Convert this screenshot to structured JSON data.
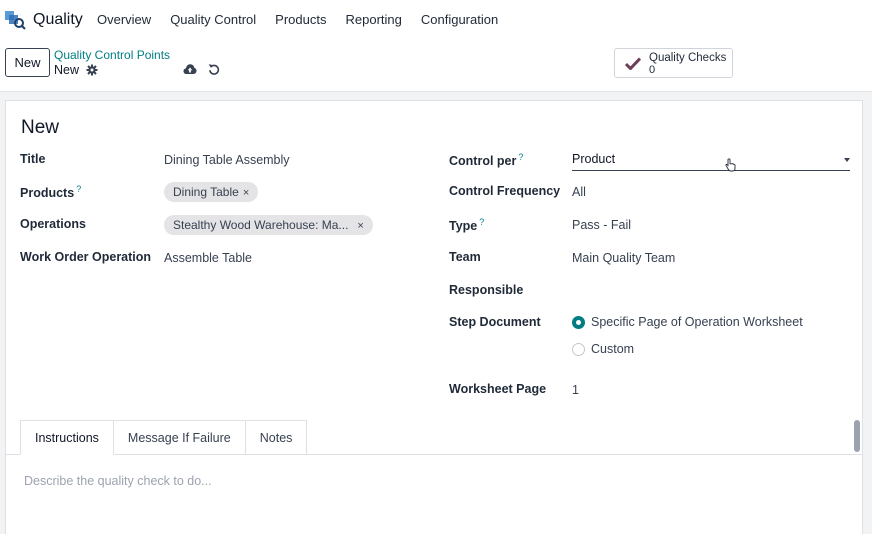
{
  "navbar": {
    "app_name": "Quality",
    "menu": [
      "Overview",
      "Quality Control",
      "Products",
      "Reporting",
      "Configuration"
    ]
  },
  "control_panel": {
    "new_label": "New",
    "breadcrumb_parent": "Quality Control Points",
    "breadcrumb_current": "New",
    "smart_button": {
      "label": "Quality Checks",
      "value": "0"
    }
  },
  "form": {
    "record_title": "New",
    "left": {
      "title_label": "Title",
      "title_value": "Dining Table Assembly",
      "products_label": "Products",
      "products_tags": [
        "Dining Table"
      ],
      "operations_label": "Operations",
      "operations_tags": [
        "Stealthy Wood Warehouse: Ma..."
      ],
      "work_order_label": "Work Order Operation",
      "work_order_value": "Assemble Table"
    },
    "right": {
      "control_per_label": "Control per",
      "control_per_value": "Product",
      "frequency_label": "Control Frequency",
      "frequency_value": "All",
      "type_label": "Type",
      "type_value": "Pass - Fail",
      "team_label": "Team",
      "team_value": "Main Quality Team",
      "responsible_label": "Responsible",
      "responsible_value": "",
      "step_document_label": "Step Document",
      "step_options": [
        "Specific Page of Operation Worksheet",
        "Custom"
      ],
      "step_selected": "Specific Page of Operation Worksheet",
      "worksheet_page_label": "Worksheet Page",
      "worksheet_page_value": "1"
    },
    "help_mark": "?"
  },
  "tabs": {
    "items": [
      "Instructions",
      "Message If Failure",
      "Notes"
    ],
    "active": "Instructions",
    "instructions_placeholder": "Describe the quality check to do..."
  },
  "colors": {
    "accent": "#017e84",
    "text": "#374151",
    "background": "#f2f3f5"
  }
}
